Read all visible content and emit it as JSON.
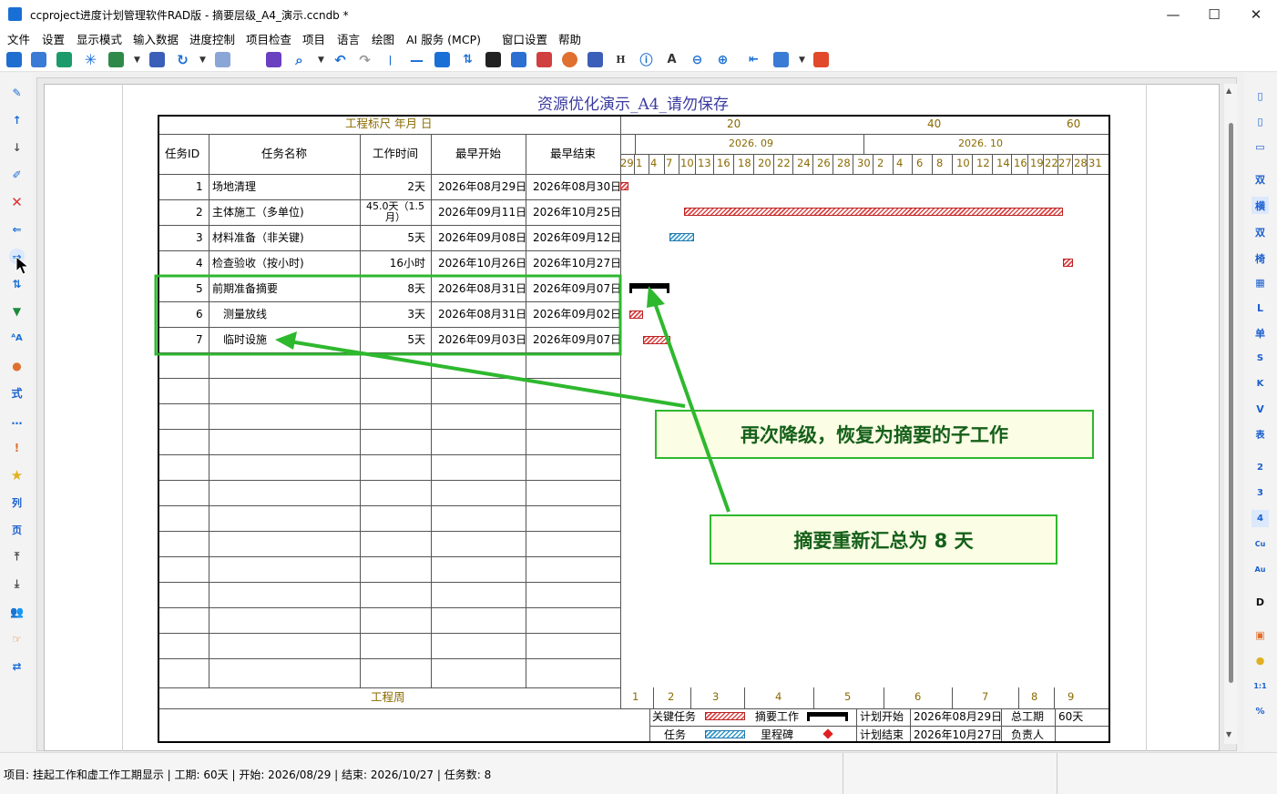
{
  "window": {
    "title": "ccproject进度计划管理软件RAD版 - 摘要层级_A4_演示.ccndb *",
    "minimize": "—",
    "maximize": "☐",
    "close": "✕"
  },
  "menu": [
    "文件",
    "设置",
    "显示模式",
    "输入数据",
    "进度控制",
    "项目检查",
    "项目",
    "语言",
    "绘图",
    "AI 服务 (MCP)",
    "窗口设置",
    "帮助"
  ],
  "chart_title": "资源优化演示_A4_请勿保存",
  "ruler": {
    "label": "工程标尺 年月 日",
    "scale": [
      "20",
      "40",
      "60"
    ],
    "months": [
      "2026. 09",
      "2026. 10"
    ],
    "days": [
      "29",
      "1",
      "4",
      "7",
      "10",
      "13",
      "16",
      "18",
      "20",
      "22",
      "24",
      "26",
      "28",
      "30",
      "2",
      "4",
      "6",
      "8",
      "10",
      "12",
      "14",
      "16",
      "19",
      "22",
      "27",
      "28",
      "31"
    ]
  },
  "columns": [
    "任务ID",
    "任务名称",
    "工作时间",
    "最早开始",
    "最早结束"
  ],
  "tasks": [
    {
      "id": "1",
      "name": "场地清理",
      "dur": "2天",
      "start": "2026年08月29日",
      "end": "2026年08月30日"
    },
    {
      "id": "2",
      "name": "主体施工（多单位)",
      "dur": "45.0天（1.5\n月）",
      "start": "2026年09月11日",
      "end": "2026年10月25日"
    },
    {
      "id": "3",
      "name": "材料准备（非关键)",
      "dur": "5天",
      "start": "2026年09月08日",
      "end": "2026年09月12日"
    },
    {
      "id": "4",
      "name": "检查验收（按小时)",
      "dur": "16小时",
      "start": "2026年10月26日",
      "end": "2026年10月27日"
    },
    {
      "id": "5",
      "name": "前期准备摘要",
      "dur": "8天",
      "start": "2026年08月31日",
      "end": "2026年09月07日"
    },
    {
      "id": "6",
      "name": "测量放线",
      "dur": "3天",
      "start": "2026年08月31日",
      "end": "2026年09月02日"
    },
    {
      "id": "7",
      "name": "临时设施",
      "dur": "5天",
      "start": "2026年09月03日",
      "end": "2026年09月07日"
    }
  ],
  "week_label": "工程周",
  "weeks": [
    "1",
    "2",
    "3",
    "4",
    "5",
    "6",
    "7",
    "8",
    "9"
  ],
  "legend": {
    "critical": "关键任务",
    "summary": "摘要工作",
    "task": "任务",
    "milestone": "里程碑",
    "plan_start_label": "计划开始",
    "plan_start": "2026年08月29日",
    "plan_end_label": "计划结束",
    "plan_end": "2026年10月27日",
    "total_label": "总工期",
    "total": "60天",
    "owner_label": "负责人",
    "owner": ""
  },
  "callouts": {
    "demote": "再次降级，恢复为摘要的子工作",
    "summary": "摘要重新汇总为 8 天"
  },
  "status": "项目: 挂起工作和虚工作工期显示 | 工期: 60天 | 开始: 2026/08/29 | 结束: 2026/10/27 | 任务数: 8",
  "right_tools": [
    "双",
    "横",
    "双",
    "椅",
    "单",
    "S",
    "K",
    "V",
    "表",
    "2",
    "3",
    "4",
    "Cu",
    "Au",
    "D",
    "1:1",
    "%"
  ],
  "left_tools": [
    "式",
    "列",
    "页"
  ],
  "toolbar_text": [
    "H"
  ]
}
